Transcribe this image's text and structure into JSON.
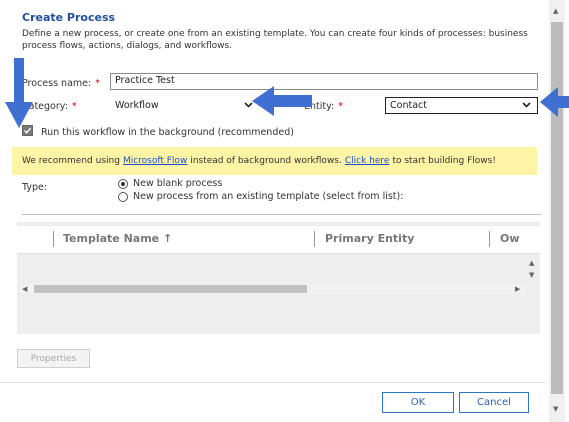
{
  "dialog": {
    "title": "Create Process",
    "description": "Define a new process, or create one from an existing template. You can create four kinds of processes: business process flows, actions, dialogs, and workflows."
  },
  "form": {
    "process_name_label": "Process name:",
    "process_name_value": "Practice Test",
    "category_label": "Category:",
    "category_value": "Workflow",
    "entity_label": "Entity:",
    "entity_value": "Contact",
    "required_marker": "*",
    "background_checkbox_label": "Run this workflow in the background (recommended)",
    "background_checked": true
  },
  "banner": {
    "text_before": "We recommend using",
    "link1": "Microsoft Flow",
    "text_middle": "instead of background workflows.",
    "link2": "Click here",
    "text_after": "to start building Flows!",
    "background_color": "#fdf4a6"
  },
  "type_section": {
    "label": "Type:",
    "options": [
      {
        "label": "New blank process",
        "selected": true
      },
      {
        "label": "New process from an existing template (select from list):",
        "selected": false
      }
    ]
  },
  "template_grid": {
    "columns": [
      "Template Name ↑",
      "Primary Entity",
      "Ow"
    ]
  },
  "buttons": {
    "properties": "Properties",
    "ok": "OK",
    "cancel": "Cancel"
  },
  "icons": {
    "dropdown": "chevron-down-icon",
    "annotation": "blue-arrow-icon",
    "checkmark": "checkmark-icon"
  },
  "colors": {
    "title": "#1f4f9c",
    "required": "#d00000",
    "link": "#1a4fd0",
    "button_border": "#2b76c8",
    "annotation_arrow": "#3f6fd1"
  }
}
